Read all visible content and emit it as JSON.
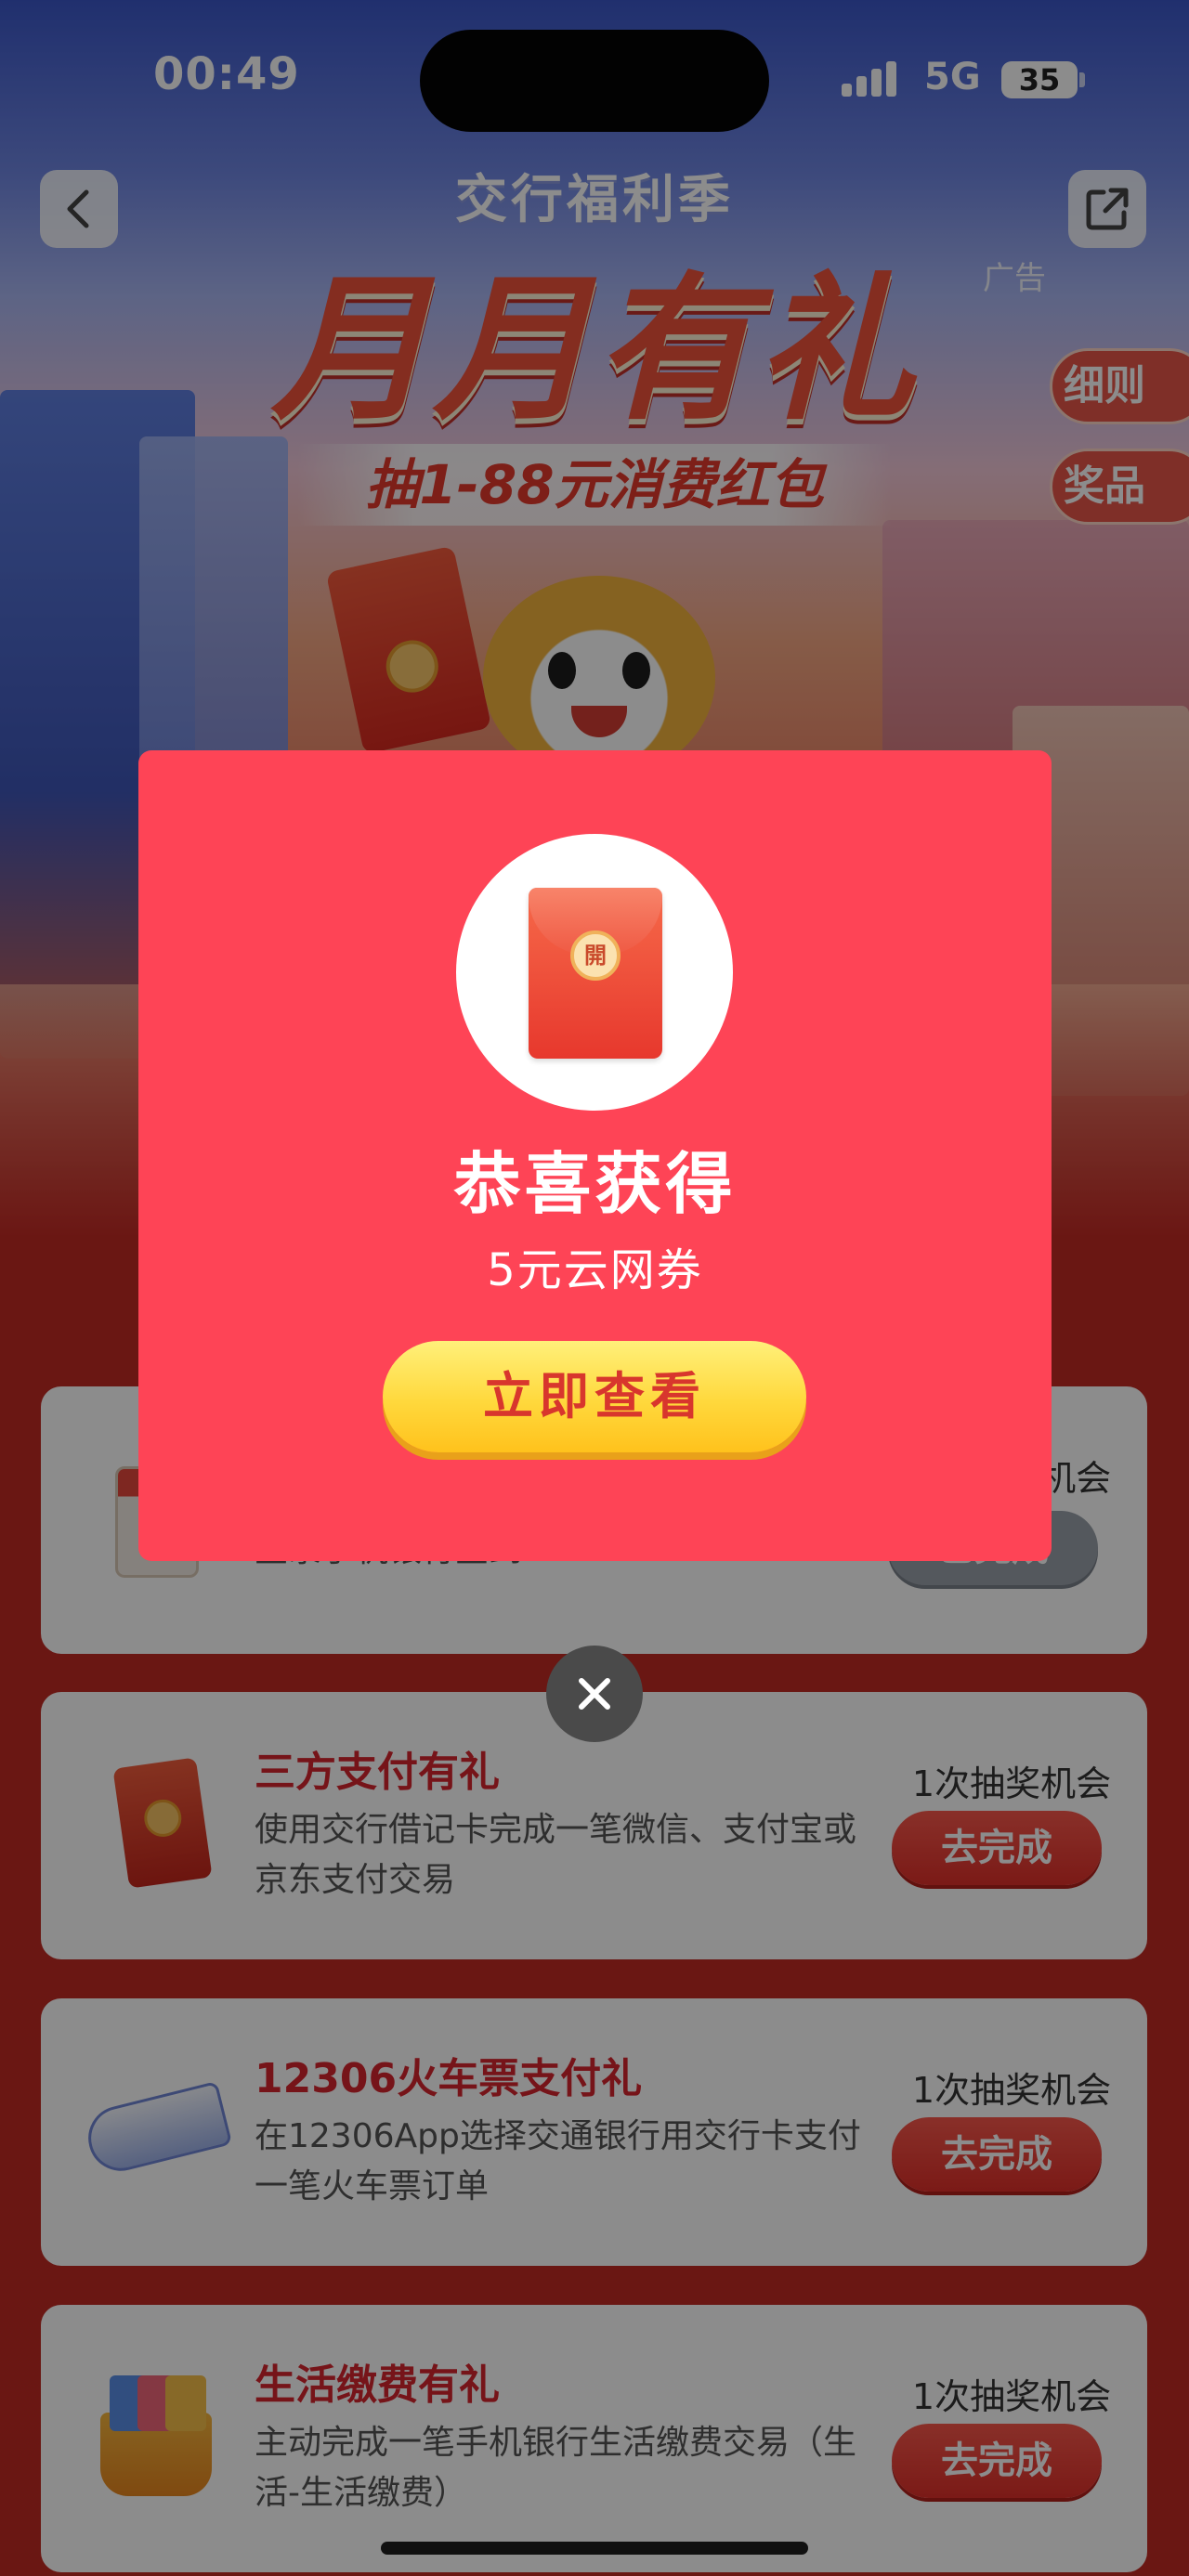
{
  "status_bar": {
    "time": "00:49",
    "network": "5G",
    "battery": "35"
  },
  "header": {
    "brand": "交行福利季",
    "headline": "月月有礼",
    "subline": "抽1-88元消费红包",
    "ad_label": "广告",
    "side_tabs": {
      "rules": "细则",
      "prizes": "奖品"
    }
  },
  "tasks": [
    {
      "title": "",
      "desc": "登录手机银行签到",
      "chance": "1次抽奖机会",
      "button": "已完成",
      "icon": "calendar-icon"
    },
    {
      "title": "三方支付有礼",
      "desc": "使用交行借记卡完成一笔微信、支付宝或京东支付交易",
      "chance": "1次抽奖机会",
      "button": "去完成",
      "icon": "red-packet-icon"
    },
    {
      "title": "12306火车票支付礼",
      "desc": "在12306App选择交通银行用交行卡支付一笔火车票订单",
      "chance": "1次抽奖机会",
      "button": "去完成",
      "icon": "train-icon"
    },
    {
      "title": "生活缴费有礼",
      "desc": "主动完成一笔手机银行生活缴费交易（生活-生活缴费）",
      "chance": "1次抽奖机会",
      "button": "去完成",
      "icon": "basket-icon"
    }
  ],
  "modal": {
    "seal_text": "開",
    "title": "恭喜获得",
    "prize": "5元云网券",
    "button": "立即查看"
  },
  "colors": {
    "modal_bg": "#fe4456",
    "accent_red": "#d7262f",
    "button_yellow": "#ffd83c"
  }
}
